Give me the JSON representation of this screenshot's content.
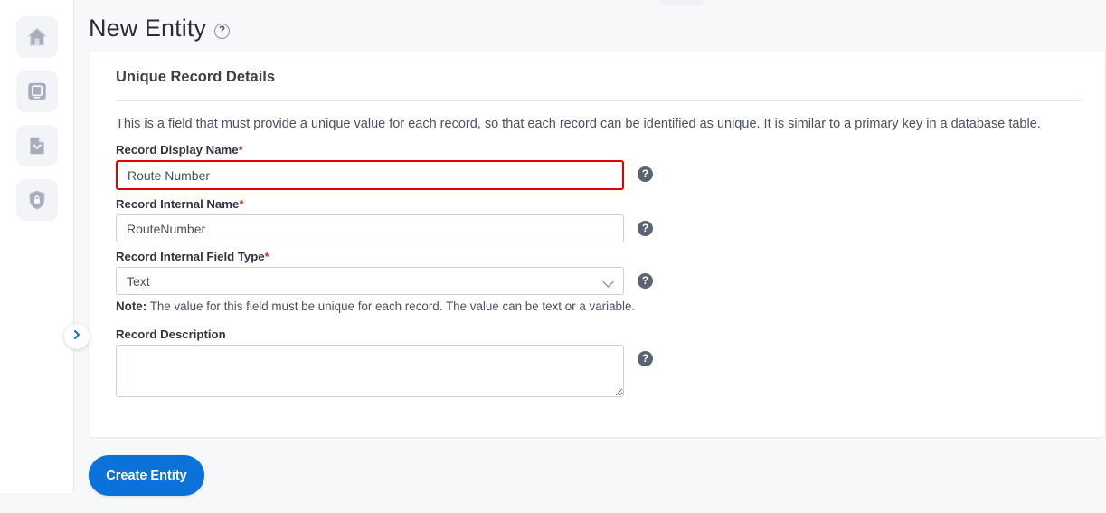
{
  "sidebar": {
    "items": [
      {
        "name": "home",
        "icon": "home-icon",
        "label": "Home"
      },
      {
        "name": "workspace",
        "icon": "monitor-icon",
        "label": "Workspace"
      },
      {
        "name": "documents",
        "icon": "document-download-icon",
        "label": "Documents"
      },
      {
        "name": "security",
        "icon": "shield-lock-icon",
        "label": "Security"
      }
    ],
    "toggle": {
      "icon": "chevron-right-icon",
      "label": "Expand navigation"
    }
  },
  "header": {
    "title": "New Entity",
    "help_icon": "help-circle-icon"
  },
  "card": {
    "title": "Unique Record Details",
    "intro": "This is a field that must provide a unique value for each record, so that each record can be identified as unique. It is similar to a primary key in a database table.",
    "fields": {
      "display_name": {
        "label": "Record Display Name",
        "required_marker": "*",
        "value": "Route Number",
        "placeholder": "",
        "help_icon": "help-icon",
        "invalid": true
      },
      "internal_name": {
        "label": "Record Internal Name",
        "required_marker": "*",
        "value": "RouteNumber",
        "placeholder": "",
        "help_icon": "help-icon"
      },
      "field_type": {
        "label": "Record Internal Field Type",
        "required_marker": "*",
        "value": "Text",
        "options": [
          "Text"
        ],
        "help_icon": "help-icon",
        "chevron_icon": "chevron-down-icon"
      },
      "description": {
        "label": "Record Description",
        "value": "",
        "placeholder": "",
        "help_icon": "help-icon"
      }
    },
    "note_prefix": "Note:",
    "note_text": " The value for this field must be unique for each record. The value can be text or a variable."
  },
  "footer": {
    "create_button": "Create Entity"
  },
  "colors": {
    "accent": "#0b72d9",
    "error": "#e00000",
    "page_bg": "#f7f8fa",
    "card_bg": "#ffffff",
    "icon_gray": "#9aa3b2"
  }
}
